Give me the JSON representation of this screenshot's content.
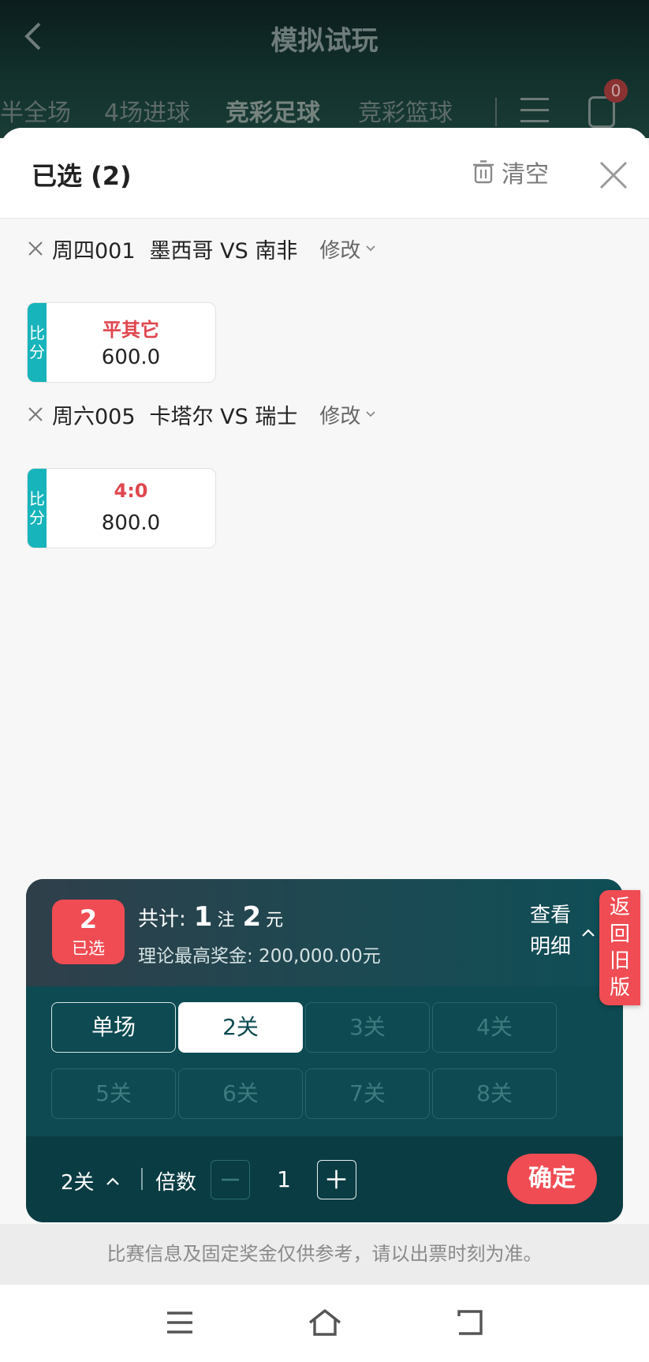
{
  "background_header": {
    "title": "模拟试玩",
    "tabs": [
      "半全场",
      "4场进球",
      "竞彩足球",
      "竞彩篮球"
    ],
    "active_tab": "竞彩足球",
    "badge_count": "0"
  },
  "panel": {
    "title": "已选 (2)",
    "clear_label": "清空"
  },
  "matches": [
    {
      "code": "周四001",
      "teams": "墨西哥 VS 南非",
      "modify_label": "修改",
      "pick": {
        "play_type": [
          "比",
          "分"
        ],
        "selection": "平其它",
        "odds": "600.0"
      }
    },
    {
      "code": "周六005",
      "teams": "卡塔尔 VS 瑞士",
      "modify_label": "修改",
      "pick": {
        "play_type": [
          "比",
          "分"
        ],
        "selection": "4:0",
        "odds": "800.0"
      }
    }
  ],
  "slip": {
    "selected_count": "2",
    "selected_label": "已选",
    "total_label": "共计:",
    "bets": "1",
    "bets_unit": "注",
    "amount": "2",
    "amount_unit": "元",
    "max_prize": "理论最高奖金: 200,000.00元",
    "detail_label": [
      "查看",
      "明细"
    ],
    "pass_options": [
      "单场",
      "2关",
      "3关",
      "4关",
      "5关",
      "6关",
      "7关",
      "8关"
    ],
    "selected_pass": "2关",
    "multiplier_label": "倍数",
    "multiplier": "1",
    "confirm_label": "确定"
  },
  "old_version_label": [
    "返",
    "回",
    "旧",
    "版"
  ],
  "disclaimer": "比赛信息及固定奖金仅供参考，请以出票时刻为准。",
  "colors": {
    "accent_red": "#f04c53",
    "teal_tag": "#17b4bb",
    "slip_bg": "#0d4a51",
    "pick_text_red": "#e0464d"
  },
  "icons": [
    "back-arrow-icon",
    "menu-icon",
    "list-icon",
    "trash-icon",
    "close-icon",
    "remove-x-icon",
    "chevron-down-icon",
    "chevron-up-icon",
    "minus-icon",
    "plus-icon",
    "nav-menu-icon",
    "nav-home-icon",
    "nav-back-icon"
  ]
}
